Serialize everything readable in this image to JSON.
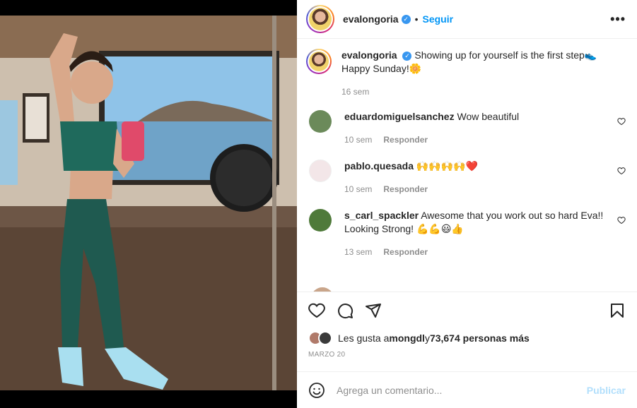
{
  "post": {
    "username": "evalongoria",
    "follow_label": "Seguir",
    "more_label": "•••"
  },
  "caption": {
    "username": "evalongoria",
    "text": "Showing up for yourself is the first step👟 Happy Sunday!🌼",
    "time": "16 sem"
  },
  "comments": [
    {
      "username": "eduardomiguelsanchez",
      "text": "Wow beautiful",
      "time": "10 sem",
      "reply": "Responder",
      "avatar_color": "#6b8a5a"
    },
    {
      "username": "pablo.quesada",
      "text": "🙌🙌🙌🙌❤️",
      "time": "10 sem",
      "reply": "Responder",
      "avatar_color": "#f3e6e8"
    },
    {
      "username": "s_carl_spackler",
      "text": "Awesome that you work out so hard Eva!! Looking Strong! 💪💪😃👍",
      "time": "13 sem",
      "reply": "Responder",
      "avatar_color": "#4f7a3a"
    }
  ],
  "likes": {
    "prefix": "Les gusta a ",
    "user": "mongdl",
    "middle": " y ",
    "count": "73,674 personas más"
  },
  "date": "MARZO 20",
  "add_comment": {
    "placeholder": "Agrega un comentario...",
    "publish_label": "Publicar"
  },
  "colors": {
    "accent": "#0095f6",
    "verified": "#3897f0",
    "publish_disabled": "#b2dffc",
    "secondary_text": "#8e8e8e"
  }
}
